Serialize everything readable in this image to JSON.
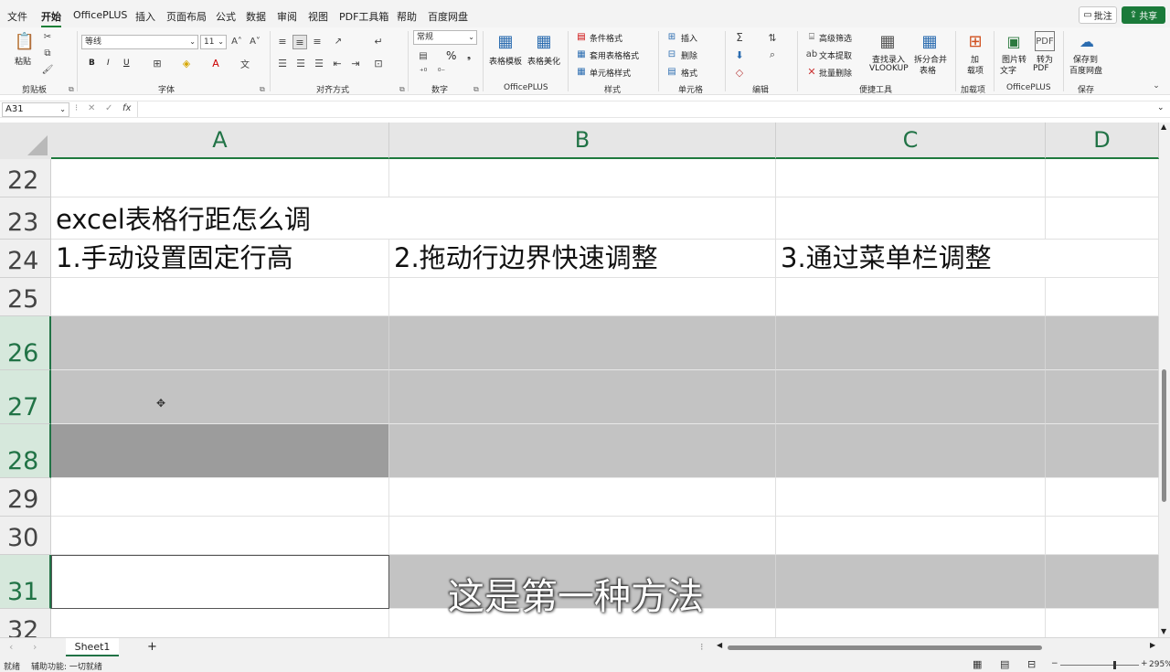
{
  "menu": {
    "items": [
      "文件",
      "开始",
      "OfficePLUS",
      "插入",
      "页面布局",
      "公式",
      "数据",
      "审阅",
      "视图",
      "PDF工具箱",
      "帮助",
      "百度网盘"
    ],
    "active": "开始",
    "comment": "批注",
    "share": "共享"
  },
  "ribbon": {
    "clipboard": {
      "paste": "粘贴",
      "label": "剪贴板"
    },
    "font": {
      "name": "等线",
      "size": "11",
      "bold": "B",
      "italic": "I",
      "underline": "U",
      "label": "字体"
    },
    "alignment": {
      "label": "对齐方式"
    },
    "number": {
      "format": "常规",
      "percent": "%",
      "label": "数字"
    },
    "officeplus1": {
      "template": "表格模板",
      "beautify": "表格美化",
      "label": "OfficePLUS"
    },
    "styles": {
      "conditional": "条件格式",
      "table_format": "套用表格格式",
      "cell_style": "单元格样式",
      "label": "样式"
    },
    "cells": {
      "insert": "插入",
      "delete": "删除",
      "format": "格式",
      "label": "单元格"
    },
    "editing": {
      "label": "编辑"
    },
    "quicktools": {
      "advanced_filter": "高级筛选",
      "text_extract": "文本提取",
      "batch_delete": "批量删除",
      "lookup_line1": "查找录入",
      "lookup_line2": "VLOOKUP",
      "split_line1": "拆分合并",
      "split_line2": "表格",
      "label": "便捷工具"
    },
    "addins": {
      "line1": "加",
      "line2": "载项",
      "label": "加载项"
    },
    "officeplus2": {
      "img_line1": "图片转",
      "img_line2": "文字",
      "pdf_line1": "转为",
      "pdf_line2": "PDF",
      "label": "OfficePLUS"
    },
    "save": {
      "line1": "保存到",
      "line2": "百度网盘",
      "label": "保存"
    }
  },
  "formula_bar": {
    "name_box": "A31",
    "fx": "fx",
    "value": ""
  },
  "columns": [
    "A",
    "B",
    "C",
    "D"
  ],
  "rows": [
    {
      "num": "22",
      "a": "",
      "b": "",
      "c": ""
    },
    {
      "num": "23",
      "a": "excel表格行距怎么调",
      "b": "",
      "c": ""
    },
    {
      "num": "24",
      "a": "1.手动设置固定行高",
      "b": "2.拖动行边界快速调整",
      "c": "3.通过菜单栏调整"
    },
    {
      "num": "25",
      "a": "",
      "b": "",
      "c": ""
    },
    {
      "num": "26",
      "a": "",
      "b": "",
      "c": ""
    },
    {
      "num": "27",
      "a": "",
      "b": "",
      "c": ""
    },
    {
      "num": "28",
      "a": "",
      "b": "",
      "c": ""
    },
    {
      "num": "29",
      "a": "",
      "b": "",
      "c": ""
    },
    {
      "num": "30",
      "a": "",
      "b": "",
      "c": ""
    },
    {
      "num": "31",
      "a": "",
      "b": "",
      "c": ""
    },
    {
      "num": "32",
      "a": "",
      "b": "",
      "c": ""
    }
  ],
  "subtitle": "这是第一种方法",
  "sheet_tabs": {
    "active": "Sheet1",
    "add": "+"
  },
  "status": {
    "ready": "就绪",
    "accessibility": "辅助功能: 一切就绪",
    "zoom": "295%"
  },
  "colors": {
    "accent": "#217346",
    "selected_rows": "#c3c3c3",
    "dark_cell": "#9c9c9c"
  }
}
